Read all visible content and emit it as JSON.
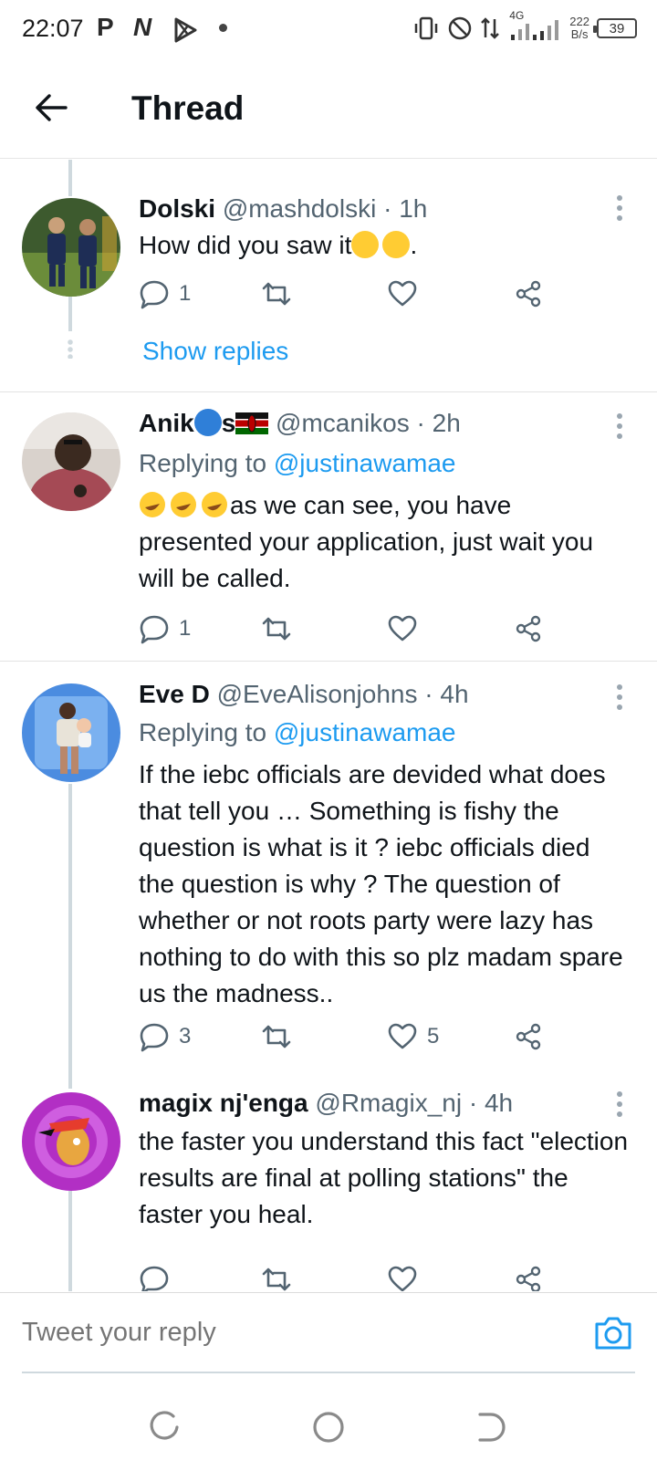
{
  "status_bar": {
    "time": "22:07",
    "icons": [
      "p-icon",
      "n-icon",
      "play-store-icon",
      "dot-icon"
    ],
    "notif_letters": [
      "P",
      "N"
    ],
    "network": "4G",
    "speed_value": "222",
    "speed_unit": "B/s",
    "battery": "39"
  },
  "header": {
    "title": "Thread",
    "back_icon": "arrow-left-icon"
  },
  "tweets": [
    {
      "name": "Dolski",
      "handle": "@mashdolski",
      "sep": "·",
      "time": "1h",
      "text": "How did you saw it",
      "text_end": ".",
      "replies": "1",
      "retweets": "",
      "likes": "",
      "show_replies": "Show replies"
    },
    {
      "name_part1": "Anik",
      "name_part2": "s",
      "handle": "@mcanikos",
      "sep": "·",
      "time": "2h",
      "replying_label": "Replying to",
      "replying_to": "@justinawamae",
      "text": "as we can see, you have presented your application, just wait you will be called.",
      "replies": "1",
      "retweets": "",
      "likes": ""
    },
    {
      "name": "Eve D",
      "handle": "@EveAlisonjohns",
      "sep": "·",
      "time": "4h",
      "replying_label": "Replying to",
      "replying_to": "@justinawamae",
      "text": "If the iebc officials are devided what does that tell you … Something is fishy the question is what is it ? iebc officials died the question is why ? The question of whether or not roots party were lazy has nothing to do with this so plz madam spare us the madness..",
      "replies": "3",
      "retweets": "",
      "likes": "5"
    },
    {
      "name": "magix nj'enga",
      "handle": "@Rmagix_nj",
      "sep": "·",
      "time": "4h",
      "text": "the faster you understand this fact \"election results are final at polling stations\" the faster you heal."
    }
  ],
  "reply_bar": {
    "placeholder": "Tweet your reply",
    "camera_icon": "camera-icon"
  },
  "colors": {
    "accent": "#1d9bf0",
    "secondary_text": "#536471",
    "primary_text": "#0f1419",
    "thread_line": "#cfd9de"
  }
}
